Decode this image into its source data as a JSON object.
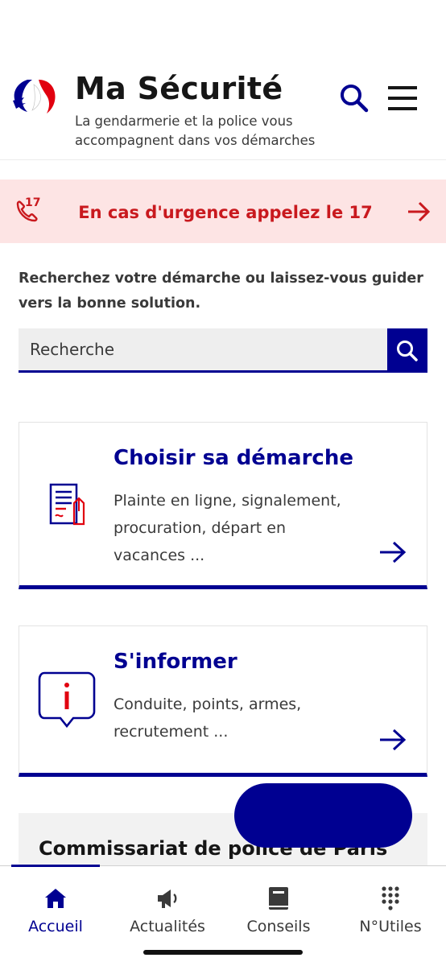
{
  "header": {
    "title": "Ma Sécurité",
    "subtitle": "La gendarmerie et la police vous accompagnent dans vos démarches"
  },
  "urgency": {
    "text": "En cas d'urgence appelez le 17",
    "phone_number": "17"
  },
  "intro": "Recherchez votre démarche ou laissez-vous guider vers la bonne solution.",
  "search": {
    "placeholder": "Recherche"
  },
  "cards": [
    {
      "title": "Choisir sa démarche",
      "description": "Plainte en ligne, signalement, procuration, départ en vacances ..."
    },
    {
      "title": "S'informer",
      "description": "Conduite, points, armes, recrutement ..."
    }
  ],
  "commissariat": {
    "title": "Commissariat de police de Paris"
  },
  "nav": {
    "items": [
      {
        "label": "Accueil",
        "icon": "home-icon"
      },
      {
        "label": "Actualités",
        "icon": "megaphone-icon"
      },
      {
        "label": "Conseils",
        "icon": "book-icon"
      },
      {
        "label": "N°Utiles",
        "icon": "keypad-icon"
      }
    ],
    "active": 0
  },
  "colors": {
    "primary": "#000091",
    "urgent": "#c9191e",
    "urgent_bg": "#fde4e4"
  }
}
